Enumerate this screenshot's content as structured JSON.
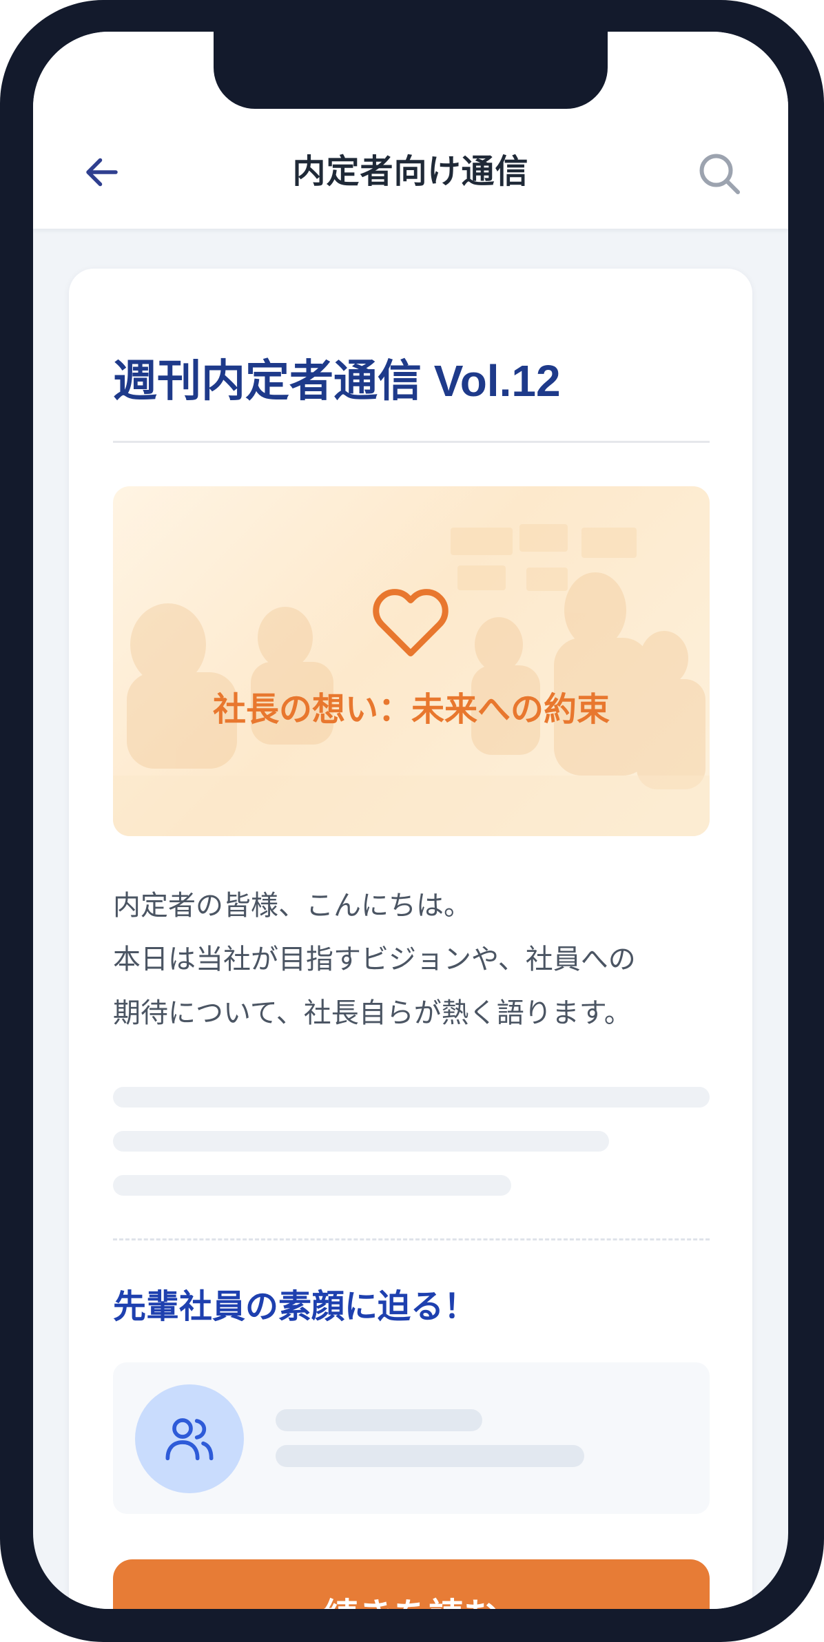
{
  "header": {
    "title": "内定者向け通信",
    "back_icon": "arrow-left-icon",
    "search_icon": "search-icon"
  },
  "article": {
    "title": "週刊内定者通信 Vol.12",
    "hero": {
      "icon": "heart-icon",
      "caption": "社長の想い：未来への約束"
    },
    "intro_lines": [
      "内定者の皆様、こんにちは。",
      "本日は当社が目指すビジョンや、社員への",
      "期待について、社長自らが熱く語ります。"
    ],
    "section_heading": "先輩社員の素顔に迫る！",
    "profile": {
      "icon": "users-icon"
    },
    "cta_label": "続きを読む"
  },
  "colors": {
    "frame": "#131a2c",
    "title": "#1e3a8a",
    "accent_orange": "#e77c36",
    "section_heading": "#1e40af",
    "avatar_bg": "#c9dcfd"
  }
}
